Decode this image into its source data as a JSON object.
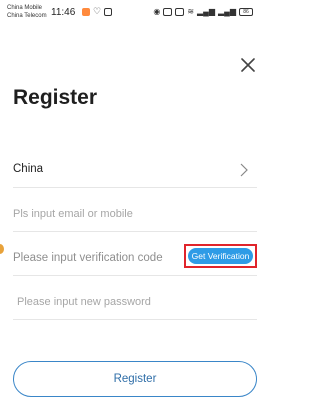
{
  "status_bar": {
    "carrier1": "China Mobile",
    "carrier2": "China Telecom",
    "time": "11:46",
    "battery": "86"
  },
  "header": {
    "close_icon": "close-icon",
    "title": "Register"
  },
  "form": {
    "country": "China",
    "email_placeholder": "Pls input email or mobile",
    "code_placeholder": "Please input verification code",
    "get_code_label": "Get Verification",
    "password_placeholder": "Please input new password",
    "register_label": "Register"
  },
  "colors": {
    "accent": "#2e9be6",
    "highlight": "#e0242b",
    "button_border": "#3a86c8"
  }
}
